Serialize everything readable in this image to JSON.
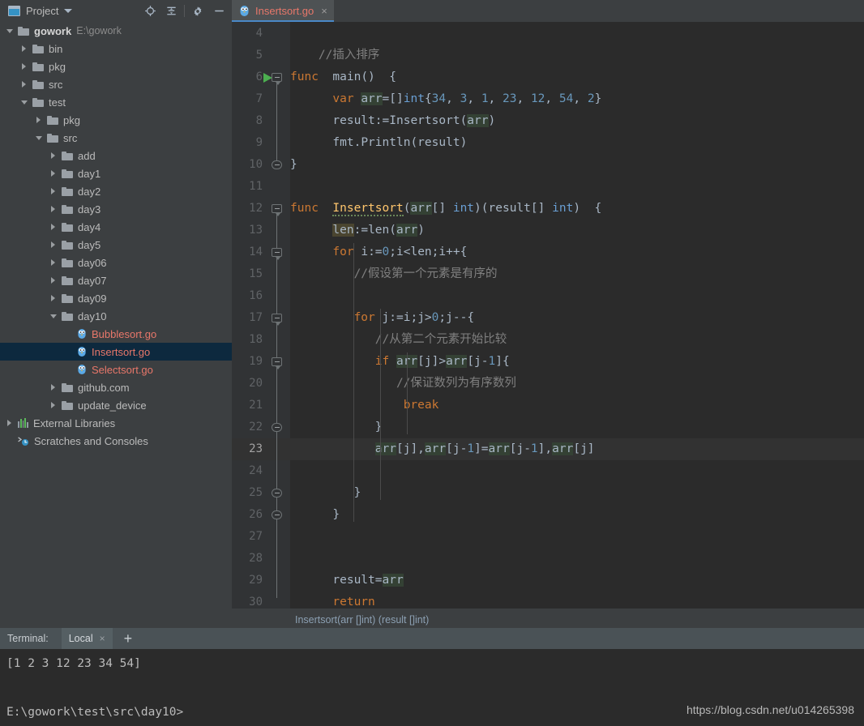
{
  "panel": {
    "title": "Project",
    "icon": "project-icon",
    "dropdown_icon": "chevron-down-icon",
    "toolbar": [
      {
        "name": "locate-icon",
        "label": "Select Opened File"
      },
      {
        "name": "collapse-all-icon",
        "label": "Collapse All"
      },
      {
        "name": "gear-icon",
        "label": "Settings"
      },
      {
        "name": "minimize-icon",
        "label": "Hide"
      }
    ]
  },
  "tabs": [
    {
      "name": "Insertsort.go",
      "icon": "go-file-icon",
      "close": "×",
      "active": true
    }
  ],
  "tree": [
    {
      "depth": 0,
      "arrow": "down",
      "icon": "folder",
      "label": "gowork",
      "bold": true,
      "suffix": "E:\\gowork"
    },
    {
      "depth": 1,
      "arrow": "right",
      "icon": "folder",
      "label": "bin"
    },
    {
      "depth": 1,
      "arrow": "right",
      "icon": "folder",
      "label": "pkg"
    },
    {
      "depth": 1,
      "arrow": "right",
      "icon": "folder",
      "label": "src"
    },
    {
      "depth": 1,
      "arrow": "down",
      "icon": "folder",
      "label": "test"
    },
    {
      "depth": 2,
      "arrow": "right",
      "icon": "folder",
      "label": "pkg"
    },
    {
      "depth": 2,
      "arrow": "down",
      "icon": "folder",
      "label": "src"
    },
    {
      "depth": 3,
      "arrow": "right",
      "icon": "folder",
      "label": "add"
    },
    {
      "depth": 3,
      "arrow": "right",
      "icon": "folder",
      "label": "day1"
    },
    {
      "depth": 3,
      "arrow": "right",
      "icon": "folder",
      "label": "day2"
    },
    {
      "depth": 3,
      "arrow": "right",
      "icon": "folder",
      "label": "day3"
    },
    {
      "depth": 3,
      "arrow": "right",
      "icon": "folder",
      "label": "day4"
    },
    {
      "depth": 3,
      "arrow": "right",
      "icon": "folder",
      "label": "day5"
    },
    {
      "depth": 3,
      "arrow": "right",
      "icon": "folder",
      "label": "day06"
    },
    {
      "depth": 3,
      "arrow": "right",
      "icon": "folder",
      "label": "day07"
    },
    {
      "depth": 3,
      "arrow": "right",
      "icon": "folder",
      "label": "day09"
    },
    {
      "depth": 3,
      "arrow": "down",
      "icon": "folder",
      "label": "day10"
    },
    {
      "depth": 4,
      "arrow": "none",
      "icon": "gofile",
      "label": "Bubblesort.go",
      "go": true
    },
    {
      "depth": 4,
      "arrow": "none",
      "icon": "gofile",
      "label": "Insertsort.go",
      "go": true,
      "selected": true
    },
    {
      "depth": 4,
      "arrow": "none",
      "icon": "gofile",
      "label": "Selectsort.go",
      "go": true
    },
    {
      "depth": 3,
      "arrow": "right",
      "icon": "folder",
      "label": "github.com"
    },
    {
      "depth": 3,
      "arrow": "right",
      "icon": "folder",
      "label": "update_device"
    },
    {
      "depth": 0,
      "arrow": "right",
      "icon": "library",
      "label": "External Libraries"
    },
    {
      "depth": 0,
      "arrow": "none",
      "icon": "scratch",
      "label": "Scratches and Consoles"
    }
  ],
  "editor": {
    "first_line": 4,
    "current_line": 23,
    "run_marker_line": 6,
    "lines": [
      {
        "n": 4,
        "code": ""
      },
      {
        "n": 5,
        "code": "    //插入排序"
      },
      {
        "n": 6,
        "code": "func  main()  {"
      },
      {
        "n": 7,
        "code": "      var arr=[]int{34, 3, 1, 23, 12, 54, 2}"
      },
      {
        "n": 8,
        "code": "      result:=Insertsort(arr)"
      },
      {
        "n": 9,
        "code": "      fmt.Println(result)"
      },
      {
        "n": 10,
        "code": "}"
      },
      {
        "n": 11,
        "code": ""
      },
      {
        "n": 12,
        "code": "func  Insertsort(arr[] int)(result[] int)  {"
      },
      {
        "n": 13,
        "code": "      len:=len(arr)"
      },
      {
        "n": 14,
        "code": "      for i:=0;i<len;i++{"
      },
      {
        "n": 15,
        "code": "         //假设第一个元素是有序的"
      },
      {
        "n": 16,
        "code": ""
      },
      {
        "n": 17,
        "code": "         for j:=i;j>0;j--{"
      },
      {
        "n": 18,
        "code": "            //从第二个元素开始比较"
      },
      {
        "n": 19,
        "code": "            if arr[j]>arr[j-1]{"
      },
      {
        "n": 20,
        "code": "               //保证数列为有序数列"
      },
      {
        "n": 21,
        "code": "                break"
      },
      {
        "n": 22,
        "code": "            }"
      },
      {
        "n": 23,
        "code": "            arr[j],arr[j-1]=arr[j-1],arr[j]"
      },
      {
        "n": 24,
        "code": ""
      },
      {
        "n": 25,
        "code": "         }"
      },
      {
        "n": 26,
        "code": "      }"
      },
      {
        "n": 27,
        "code": ""
      },
      {
        "n": 28,
        "code": ""
      },
      {
        "n": 29,
        "code": "      result=arr"
      },
      {
        "n": 30,
        "code": "      return"
      }
    ],
    "status_hint": "Insertsort(arr []int) (result []int)"
  },
  "terminal": {
    "label": "Terminal:",
    "tab": "Local",
    "tab_close": "×",
    "add": "+",
    "output": "[1 2 3 12 23 34 54]",
    "prompt": "E:\\gowork\\test\\src\\day10>"
  },
  "watermark": "https://blog.csdn.net/u014265398",
  "colors": {
    "accent": "#4a88c7",
    "go_file": "#e8776a",
    "keyword": "#cc7832",
    "number": "#6897bb",
    "comment": "#808080",
    "function": "#ffc66d",
    "selection": "#0d293e"
  }
}
